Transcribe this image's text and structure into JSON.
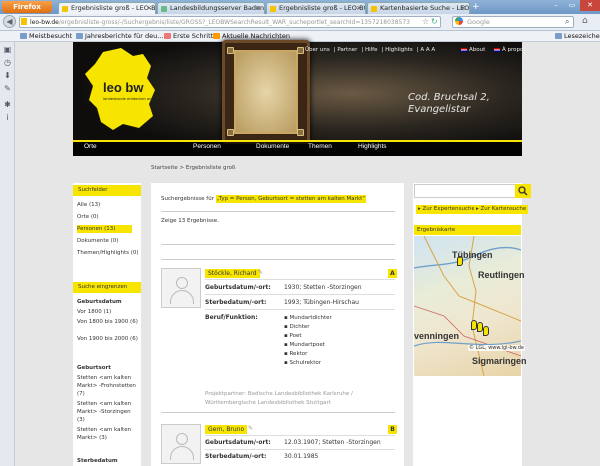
{
  "browser": {
    "app_button": "Firefox",
    "tabs": [
      {
        "label": "Ergebnisliste groß - LEO-BW",
        "active": true
      },
      {
        "label": "Landesbildungsserver Baden-Württe..."
      },
      {
        "label": "Ergebnisliste groß - LEO-BW"
      },
      {
        "label": "Kartenbasierte Suche - LEO-BW"
      }
    ],
    "url_host": "leo-bw.de",
    "url_rest": "/ergebnisliste-gross/-/Suchergebnis/liste/GROSS?_LEOBWSearchResult_WAR_sucheportlet_searchId=1357218038573",
    "search_engine": "Google",
    "bookmarks": [
      "Meistbesucht",
      "Jahresberichte für deu...",
      "Erste Schritte",
      "Aktuelle Nachrichten"
    ],
    "bookmarks_right": "Lesezeichen"
  },
  "header": {
    "topnav": [
      "Über uns",
      "Partner",
      "Hilfe",
      "Highlights",
      "A A A"
    ],
    "about": "About",
    "apropos": "À propos",
    "object_title_1": "Cod. Bruchsal 2,",
    "object_title_2": "Evangelistar",
    "mainnav": [
      "Orte",
      "Personen",
      "Dokumente",
      "Themen",
      "Highlights"
    ],
    "logo_text": "leo bw",
    "logo_sub": "landeskunde entdecken online"
  },
  "breadcrumb": "Startseite > Ergebnisliste groß",
  "left": {
    "suchfelder_title": "Suchfelder",
    "suchfelder": [
      "Alle (13)",
      "Orte (0)",
      "Personen (13)",
      "Dokumente (0)",
      "Themen/Highlights (0)"
    ],
    "eingrenzen_title": "Suche eingrenzen",
    "geburtsdatum_title": "Geburtsdatum",
    "geburtsdatum": [
      "Vor 1800 (1)",
      "Von 1800 bis 1900 (6)",
      "Von 1900 bis 2000 (6)"
    ],
    "geburtsort_title": "Geburtsort",
    "geburtsort": [
      "Stetten <am kalten Markt> -Frohnstetten (7)",
      "Stetten <am kalten Markt> -Storzingen (3)",
      "Stetten <am kalten Markt> (3)"
    ],
    "sterbedatum_title": "Sterbedatum"
  },
  "main": {
    "result_prefix": "Suchergebnisse für",
    "result_query": "„Typ = Person, Geburtsort = stetten am kalten Markt“",
    "count_text": "Zeige 13 Ergebnisse.",
    "persons": [
      {
        "name": "Stöckle, Richard",
        "letter": "A",
        "geb_label": "Geburtsdatum/-ort:",
        "geb_value": "1930; Stetten -Storzingen",
        "sterbe_label": "Sterbedatum/-ort:",
        "sterbe_value": "1993; Tübingen-Hirschau",
        "beruf_label": "Beruf/Funktion:",
        "beruf": [
          "Mundartdichter",
          "Dichter",
          "Poet",
          "Mundartpoet",
          "Rektor",
          "Schulrektor"
        ],
        "projekt": "Projektpartner: Badische Landesbibliothek Karlsruhe / Württembergische Landesbibliothek Stuttgart"
      },
      {
        "name": "Gern, Bruno",
        "letter": "B",
        "geb_label": "Geburtsdatum/-ort:",
        "geb_value": "12.03.1907; Stetten -Storzingen",
        "sterbe_label": "Sterbedatum/-ort:",
        "sterbe_value": "30.01.1985"
      }
    ]
  },
  "right": {
    "expert_link": "Zur Expertensuche",
    "map_link": "Zur Kartensuche",
    "map_title": "Ergebniskarte",
    "towns": [
      "Tübingen",
      "Reutlingen",
      "venningen",
      "Sigmaringen"
    ],
    "copyright": "© LGL, www.lgl-bw.de",
    "accent": "#f7e500"
  }
}
